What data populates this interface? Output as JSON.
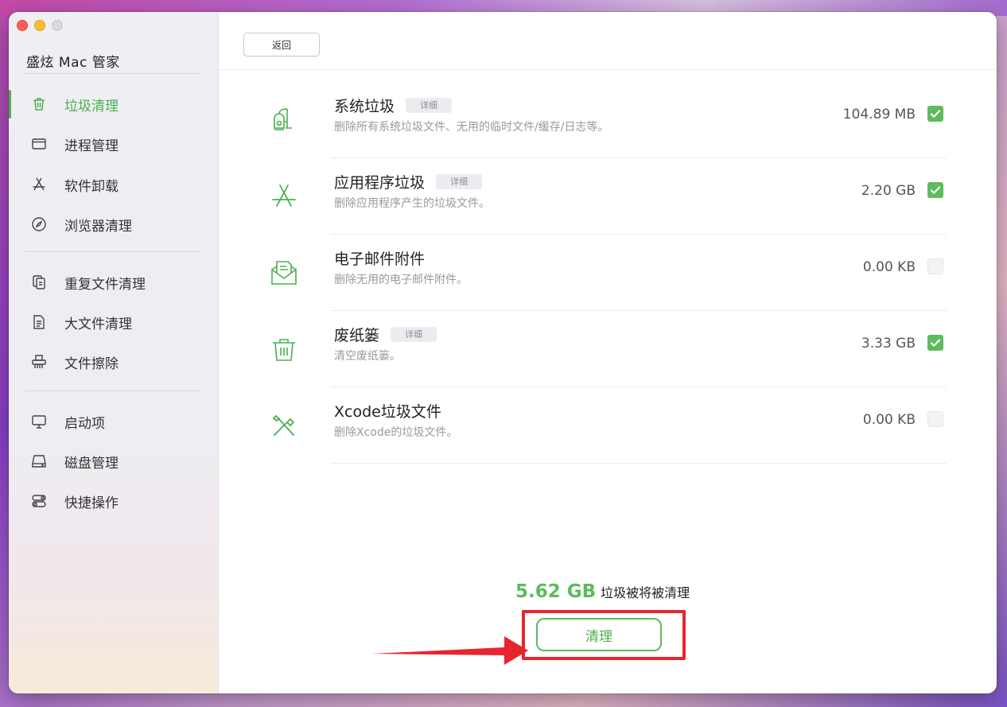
{
  "app": {
    "title": "盛炫 Mac 管家"
  },
  "sidebar": {
    "items": [
      {
        "label": "垃圾清理",
        "icon": "trash-icon",
        "active": true
      },
      {
        "label": "进程管理",
        "icon": "window-icon",
        "active": false
      },
      {
        "label": "软件卸载",
        "icon": "app-store-icon",
        "active": false
      },
      {
        "label": "浏览器清理",
        "icon": "compass-icon",
        "active": false
      },
      {
        "label": "重复文件清理",
        "icon": "duplicate-files-icon",
        "active": false
      },
      {
        "label": "大文件清理",
        "icon": "document-icon",
        "active": false
      },
      {
        "label": "文件擦除",
        "icon": "shredder-icon",
        "active": false
      },
      {
        "label": "启动项",
        "icon": "monitor-icon",
        "active": false
      },
      {
        "label": "磁盘管理",
        "icon": "disk-icon",
        "active": false
      },
      {
        "label": "快捷操作",
        "icon": "toggle-icon",
        "active": false
      }
    ]
  },
  "toolbar": {
    "back_label": "返回"
  },
  "items": [
    {
      "name": "系统垃圾",
      "detail": "详细",
      "desc": "删除所有系统垃圾文件、无用的临时文件/缓存/日志等。",
      "size": "104.89 MB",
      "checked": true,
      "icon": "vacuum-icon"
    },
    {
      "name": "应用程序垃圾",
      "detail": "详细",
      "desc": "删除应用程序产生的垃圾文件。",
      "size": "2.20 GB",
      "checked": true,
      "icon": "app-store-icon"
    },
    {
      "name": "电子邮件附件",
      "detail": "",
      "desc": "删除无用的电子邮件附件。",
      "size": "0.00 KB",
      "checked": false,
      "icon": "mail-icon"
    },
    {
      "name": "废纸篓",
      "detail": "详细",
      "desc": "清空废纸篓。",
      "size": "3.33 GB",
      "checked": true,
      "icon": "trash-can-icon"
    },
    {
      "name": "Xcode垃圾文件",
      "detail": "",
      "desc": "删除Xcode的垃圾文件。",
      "size": "0.00 KB",
      "checked": false,
      "icon": "tools-icon"
    }
  ],
  "summary": {
    "amount": "5.62 GB",
    "text": "垃圾被将被清理"
  },
  "action": {
    "clean_label": "清理"
  },
  "colors": {
    "accent": "#5cbb5c",
    "highlight": "#e8242e"
  }
}
